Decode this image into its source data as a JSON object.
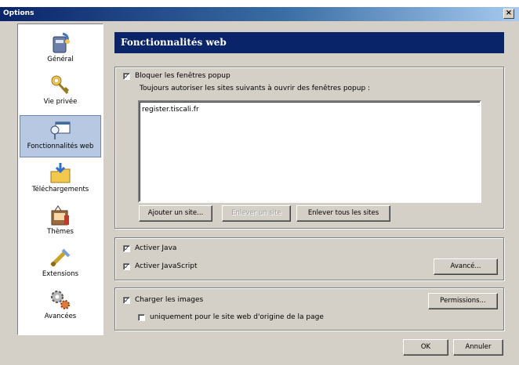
{
  "window": {
    "title": "Options",
    "close_label": "×"
  },
  "sidebar": {
    "items": [
      {
        "label": "Général",
        "icon": "general-icon"
      },
      {
        "label": "Vie privée",
        "icon": "key-icon"
      },
      {
        "label": "Fonctionnalités web",
        "icon": "web-features-icon",
        "selected": true
      },
      {
        "label": "Téléchargements",
        "icon": "downloads-folder-icon"
      },
      {
        "label": "Thèmes",
        "icon": "themes-icon"
      },
      {
        "label": "Extensions",
        "icon": "extensions-icon"
      },
      {
        "label": "Avancées",
        "icon": "advanced-gears-icon"
      }
    ]
  },
  "header": {
    "title": "Fonctionnalités web"
  },
  "popup": {
    "block_label": "Bloquer les fenêtres popup",
    "block_checked": true,
    "allow_text": "Toujours autoriser les sites suivants à ouvrir des fenêtres popup :",
    "sites": [
      "register.tiscali.fr"
    ],
    "add_button": "Ajouter un site...",
    "remove_button": "Enlever un site",
    "remove_all_button": "Enlever tous les sites"
  },
  "java": {
    "java_label": "Activer Java",
    "java_checked": true,
    "js_label": "Activer JavaScript",
    "js_checked": true,
    "advanced_button": "Avancé..."
  },
  "images": {
    "load_label": "Charger les images",
    "load_checked": true,
    "origin_label": "uniquement pour le site web d'origine de la page",
    "origin_checked": false,
    "permissions_button": "Permissions..."
  },
  "footer": {
    "ok_button": "OK",
    "cancel_button": "Annuler"
  }
}
